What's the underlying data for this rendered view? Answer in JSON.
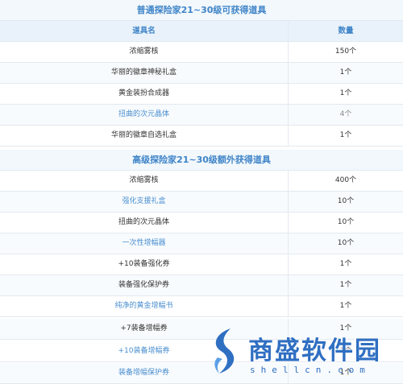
{
  "section1": {
    "title": "普通探险家21~30级可获得道具",
    "header": {
      "name": "道具名",
      "qty": "数量"
    },
    "rows": [
      {
        "name": "浓缩雾核",
        "qty": "150个"
      },
      {
        "name": "华丽的徽章神秘礼盒",
        "qty": "1个"
      },
      {
        "name": "黄金装扮合成器",
        "qty": "1个"
      },
      {
        "name": "扭曲的次元晶体",
        "qty": "4个"
      },
      {
        "name": "华丽的徽章自选礼盒",
        "qty": "1个"
      }
    ]
  },
  "section2": {
    "title": "高级探险家21~30级额外获得道具",
    "rows": [
      {
        "name": "浓缩雾核",
        "qty": "400个"
      },
      {
        "name": "强化支援礼盒",
        "qty": "10个"
      },
      {
        "name": "扭曲的次元晶体",
        "qty": "10个"
      },
      {
        "name": "一次性增幅器",
        "qty": "10个"
      },
      {
        "name": "+10装备强化券",
        "qty": "1个"
      },
      {
        "name": "装备强化保护券",
        "qty": "1个"
      },
      {
        "name": "纯净的黄金增幅书",
        "qty": "1个"
      },
      {
        "name": "+7装备增幅券",
        "qty": "1个"
      },
      {
        "name": "+10装备增幅券",
        "qty": "1个"
      },
      {
        "name": "装备增幅保护券",
        "qty": "1个"
      }
    ]
  },
  "watermark": {
    "brand": "商盛软件园",
    "domain": "shellcn.com"
  },
  "colors": {
    "accent": "#3f84c8",
    "link": "#4a8fd0",
    "header_bg": "#e9f2fa",
    "border": "#e3e9f0"
  }
}
